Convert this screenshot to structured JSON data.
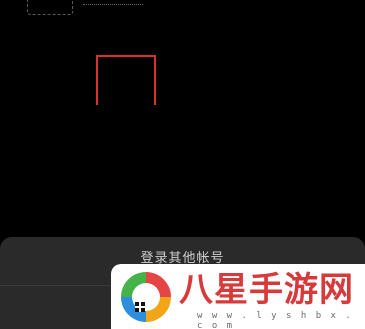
{
  "sheet": {
    "title": "登录其他帐号"
  },
  "watermark": {
    "title": "八星手游网",
    "url": "w w w . l y s h b x . c o m"
  },
  "colors": {
    "background": "#000000",
    "sheet": "#2a2a2a",
    "highlight_border": "#d8322b",
    "watermark_red": "#d63a3a"
  }
}
